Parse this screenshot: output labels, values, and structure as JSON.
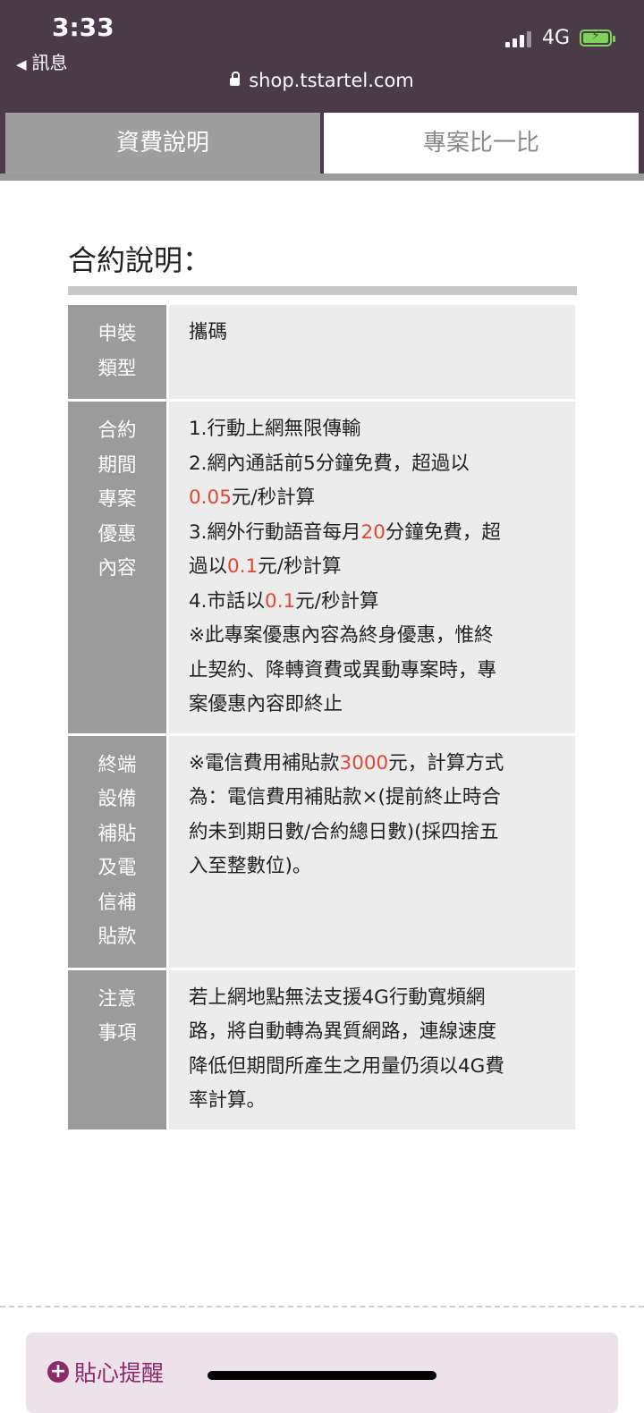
{
  "status_bar": {
    "time": "3:33",
    "back_label": "訊息",
    "network": "4G"
  },
  "browser": {
    "url": "shop.tstartel.com"
  },
  "tabs": [
    {
      "label": "資費說明",
      "active": true
    },
    {
      "label": "專案比一比",
      "active": false
    }
  ],
  "section_title": "合約說明：",
  "table": {
    "rows": [
      {
        "label_lines": [
          "申裝",
          "類型"
        ],
        "value_lines": [
          [
            {
              "t": "攜碼"
            }
          ]
        ]
      },
      {
        "label_lines": [
          "合約",
          "期間",
          "專案",
          "優惠",
          "內容"
        ],
        "value_lines": [
          [
            {
              "t": "1.行動上網無限傳輸"
            }
          ],
          [
            {
              "t": "2.網內通話前5分鐘免費，超過以"
            }
          ],
          [
            {
              "t": "0.05",
              "red": true
            },
            {
              "t": "元/秒計算"
            }
          ],
          [
            {
              "t": "3.網外行動語音每月"
            },
            {
              "t": "20",
              "red": true
            },
            {
              "t": "分鐘免費，超"
            }
          ],
          [
            {
              "t": "過以"
            },
            {
              "t": "0.1",
              "red": true
            },
            {
              "t": "元/秒計算"
            }
          ],
          [
            {
              "t": "4.市話以"
            },
            {
              "t": "0.1",
              "red": true
            },
            {
              "t": "元/秒計算"
            }
          ],
          [
            {
              "t": "※此專案優惠內容為終身優惠，惟終"
            }
          ],
          [
            {
              "t": "止契約、降轉資費或異動專案時，專"
            }
          ],
          [
            {
              "t": "案優惠內容即終止"
            }
          ]
        ]
      },
      {
        "label_lines": [
          "終端",
          "設備",
          "補貼",
          "及電",
          "信補",
          "貼款"
        ],
        "value_lines": [
          [
            {
              "t": "※電信費用補貼款"
            },
            {
              "t": "3000",
              "red": true
            },
            {
              "t": "元，計算方式"
            }
          ],
          [
            {
              "t": "為：電信費用補貼款×(提前終止時合"
            }
          ],
          [
            {
              "t": "約未到期日數/合約總日數)(採四捨五"
            }
          ],
          [
            {
              "t": "入至整數位)。"
            }
          ]
        ]
      },
      {
        "label_lines": [
          "注意",
          "事項"
        ],
        "value_lines": [
          [
            {
              "t": "若上網地點無法支援4G行動寬頻網"
            }
          ],
          [
            {
              "t": "路，將自動轉為異質網路，連線速度"
            }
          ],
          [
            {
              "t": "降低但期間所產生之用量仍須以4G費"
            }
          ],
          [
            {
              "t": "率計算。"
            }
          ]
        ]
      }
    ]
  },
  "reminder": {
    "label": "貼心提醒"
  },
  "colors": {
    "header_bg": "#4b3a47",
    "accent": "#8d2a69",
    "highlight": "#e04834"
  },
  "icons": [
    "lock-icon",
    "back-arrow-icon",
    "signal-icon",
    "battery-charging-icon",
    "plus-circle-icon"
  ]
}
